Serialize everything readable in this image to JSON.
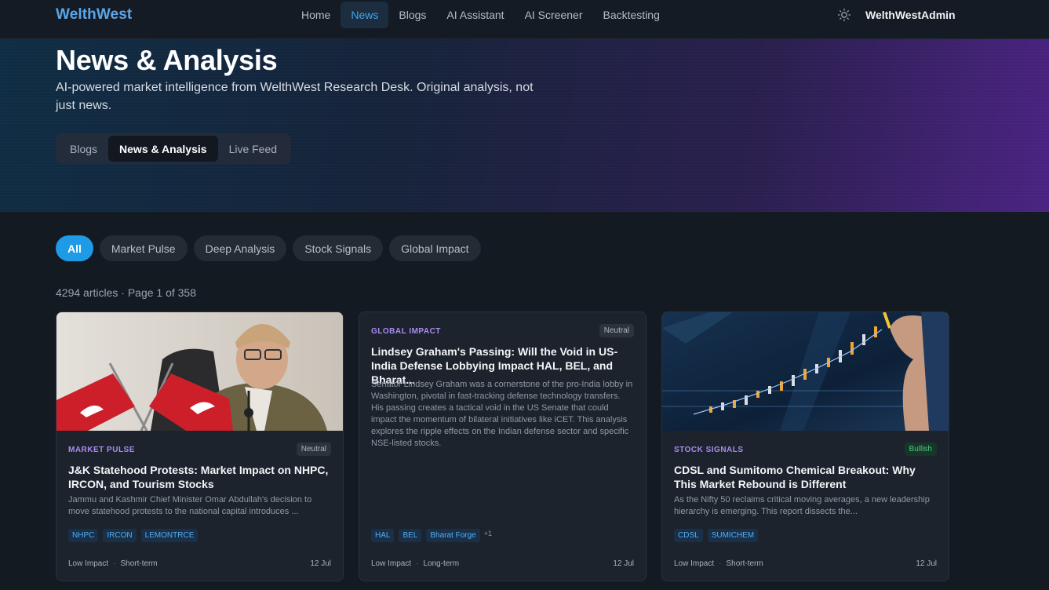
{
  "app": {
    "logo": "WelthWest",
    "nav": [
      "Home",
      "News",
      "Blogs",
      "AI Assistant",
      "AI Screener",
      "Backtesting"
    ],
    "active_nav": "News",
    "user": "WelthWestAdmin",
    "theme_icon": "sun-icon"
  },
  "hero": {
    "title": "News & Analysis",
    "subtitle": "AI-powered market intelligence from WelthWest Research Desk. Original analysis, not just news.",
    "view_tabs": [
      "Blogs",
      "News & Analysis",
      "Live Feed"
    ],
    "active_view": "News & Analysis"
  },
  "filters": {
    "chips": [
      "All",
      "Market Pulse",
      "Deep Analysis",
      "Stock Signals",
      "Global Impact"
    ],
    "active": "All"
  },
  "results": {
    "summary": "4294 articles · Page 1 of 358"
  },
  "cards": [
    {
      "category": "MARKET PULSE",
      "sentiment": "Neutral",
      "title": "J&K Statehood Protests: Market Impact on NHPC, IRCON, and Tourism Stocks",
      "description": "Jammu and Kashmir Chief Minister Omar Abdullah's decision to move statehood protests to the national capital introduces ...",
      "tags": [
        "NHPC",
        "IRCON",
        "LEMONTRCE"
      ],
      "impact": "Low Impact",
      "horizon": "Short-term",
      "date": "12 Jul"
    },
    {
      "category": "GLOBAL IMPACT",
      "sentiment": "Neutral",
      "title": "Lindsey Graham's Passing: Will the Void in US-India Defense Lobbying Impact HAL, BEL, and Bharat...",
      "description": "Senator Lindsey Graham was a cornerstone of the pro-India lobby in Washington, pivotal in fast-tracking defense technology transfers. His passing creates a tactical void in the US Senate that could impact the momentum of bilateral initiatives like iCET. This analysis explores the ripple effects on the Indian defense sector and specific NSE-listed stocks.",
      "tags": [
        "HAL",
        "BEL",
        "Bharat Forge"
      ],
      "more_tags": "+1",
      "impact": "Low Impact",
      "horizon": "Long-term",
      "date": "12 Jul"
    },
    {
      "category": "STOCK SIGNALS",
      "sentiment": "Bullish",
      "title": "CDSL and Sumitomo Chemical Breakout: Why This Market Rebound is Different",
      "description": "As the Nifty 50 reclaims critical moving averages, a new leadership hierarchy is emerging. This report dissects the...",
      "tags": [
        "CDSL",
        "SUMICHEM"
      ],
      "impact": "Low Impact",
      "horizon": "Short-term",
      "date": "12 Jul"
    }
  ]
}
